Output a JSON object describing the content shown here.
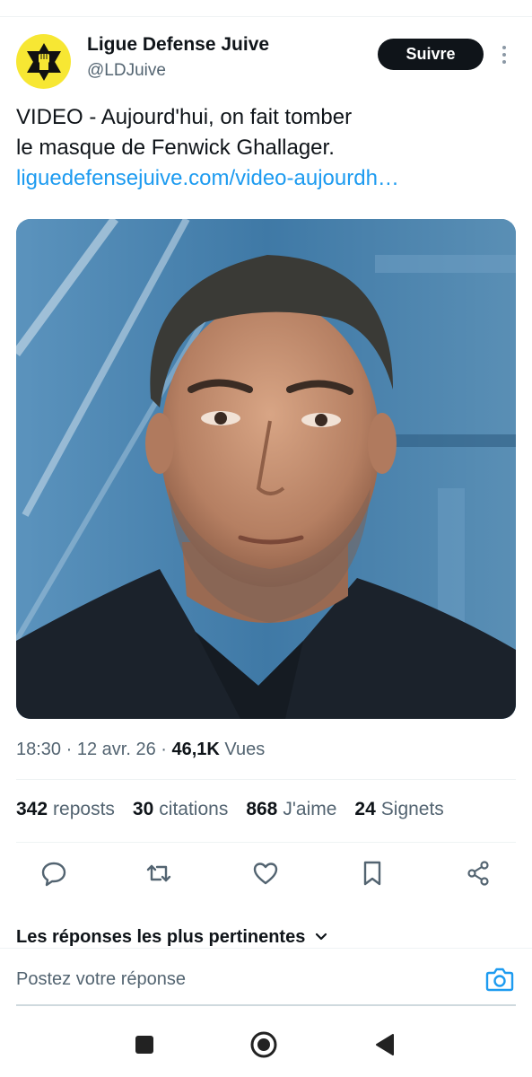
{
  "post": {
    "author_name": "Ligue Defense Juive",
    "author_handle": "@LDJuive",
    "follow_label": "Suivre",
    "text_line1": "VIDEO - Aujourd'hui, on fait tomber",
    "text_line2": "le masque de Fenwick Ghallager.",
    "link": "liguedefensejuive.com/video-aujourdh…",
    "time": "18:30",
    "date": "12 avr. 26",
    "views_count": "46,1K",
    "views_label": "Vues"
  },
  "stats": {
    "reposts_count": "342",
    "reposts_label": "reposts",
    "quotes_count": "30",
    "quotes_label": "citations",
    "likes_count": "868",
    "likes_label": "J'aime",
    "bookmarks_count": "24",
    "bookmarks_label": "Signets"
  },
  "replies": {
    "sort_label": "Les réponses les plus pertinentes",
    "input_placeholder": "Postez votre réponse"
  },
  "icons": {
    "more": "more-vertical-icon",
    "reply": "reply-icon",
    "repost": "repost-icon",
    "like": "heart-icon",
    "bookmark": "bookmark-icon",
    "share": "share-icon",
    "camera": "camera-icon",
    "nav_recents": "square-icon",
    "nav_home": "circle-icon",
    "nav_back": "back-triangle-icon"
  },
  "colors": {
    "accent_blue": "#1d9bf0",
    "text_primary": "#0f1419",
    "text_secondary": "#536471",
    "avatar_yellow": "#f7e733",
    "follow_bg": "#0f1419"
  }
}
